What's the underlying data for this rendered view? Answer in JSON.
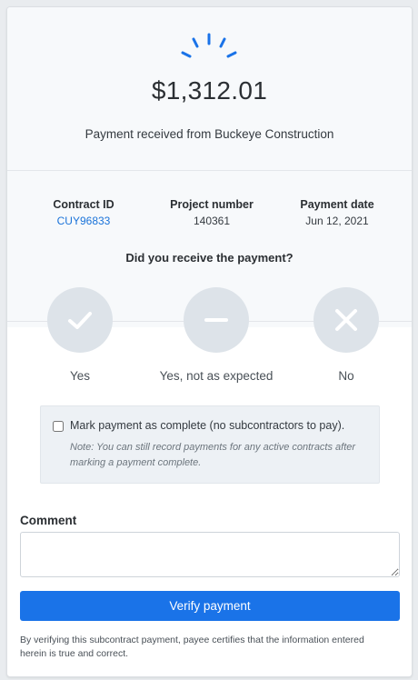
{
  "header": {
    "amount": "$1,312.01",
    "received_text": "Payment received from Buckeye Construction"
  },
  "details": {
    "contract_id": {
      "label": "Contract ID",
      "value": "CUY96833"
    },
    "project_number": {
      "label": "Project number",
      "value": "140361"
    },
    "payment_date": {
      "label": "Payment date",
      "value": "Jun 12, 2021"
    }
  },
  "question": "Did you receive the payment?",
  "options": [
    {
      "label": "Yes",
      "icon": "check-icon"
    },
    {
      "label": "Yes, not as expected",
      "icon": "minus-icon"
    },
    {
      "label": "No",
      "icon": "x-icon"
    }
  ],
  "complete": {
    "label": "Mark payment as complete (no subcontractors to pay).",
    "note": "Note: You can still record payments for any active contracts after marking a payment complete.",
    "checked": false
  },
  "comment": {
    "label": "Comment",
    "value": ""
  },
  "verify_button": "Verify payment",
  "disclaimer": "By verifying this subcontract payment, payee certifies that the information entered herein is true and correct.",
  "colors": {
    "accent": "#1a73e8",
    "link": "#1a73d9",
    "option_circle": "#dde3e9"
  }
}
